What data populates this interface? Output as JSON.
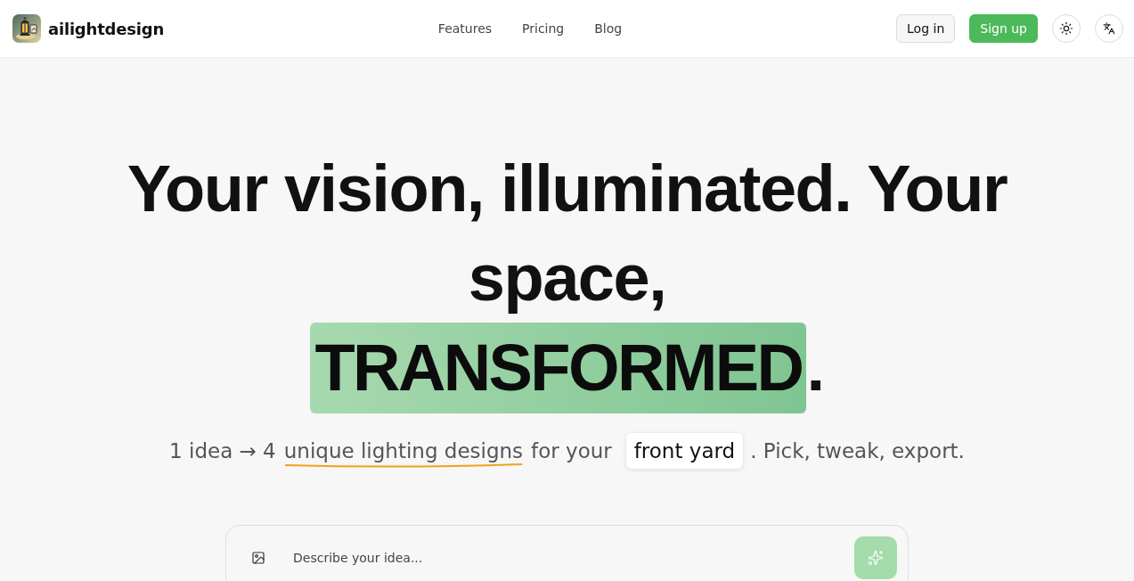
{
  "header": {
    "brand": "ailightdesign",
    "nav": [
      {
        "label": "Features"
      },
      {
        "label": "Pricing"
      },
      {
        "label": "Blog"
      }
    ],
    "buttons": [
      {
        "label": "Log in",
        "kind": "secondary"
      },
      {
        "label": "Sign up",
        "kind": "primary"
      }
    ]
  },
  "hero": {
    "headline": "Your vision, illuminated. Your space,",
    "highlight": "TRANSFORMED",
    "headline_end": ".",
    "subtitle": {
      "lead": "1 idea → 4",
      "underlined": "unique lighting designs",
      "middle": "for your",
      "chip": "front yard",
      "tail": ". Pick, tweak, export."
    }
  },
  "prompt": {
    "placeholder": "Describe your idea..."
  }
}
